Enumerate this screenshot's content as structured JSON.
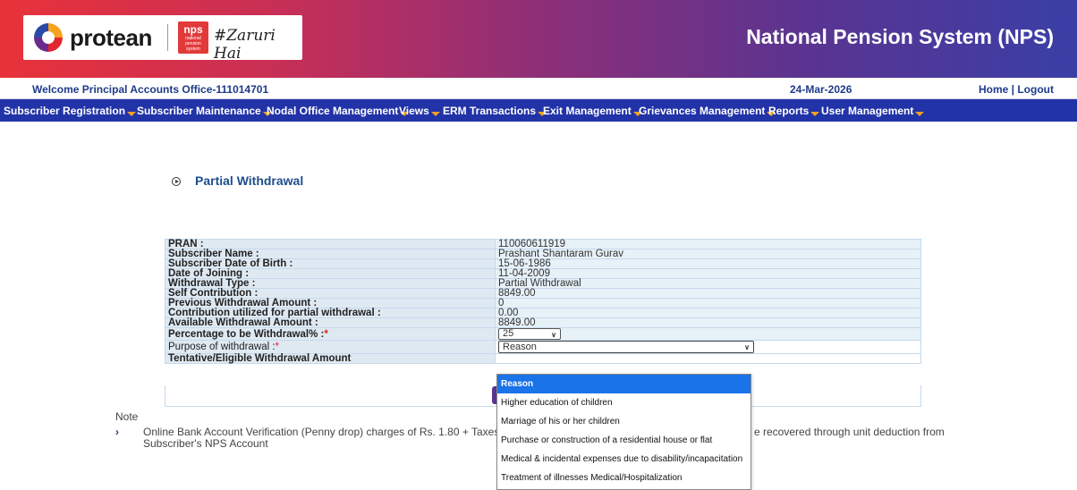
{
  "header": {
    "brand_name": "protean",
    "nps_badge_title": "nps",
    "nps_badge_sub": "national pension system",
    "tagline": "#Zaruri Hai",
    "site_title": "National Pension System (NPS)",
    "brand_colors": [
      "#e8323a",
      "#8e2f78",
      "#3a3fa6"
    ]
  },
  "info_bar": {
    "welcome": "Welcome Principal Accounts Office-111014701",
    "date": "24-Mar-2026",
    "home_logout": "Home | Logout"
  },
  "nav": {
    "items": [
      "Subscriber Registration",
      "Subscriber Maintenance",
      "Nodal Office Management",
      "Views",
      "ERM Transactions",
      "Exit Management",
      "Grievances Management",
      "Reports",
      "User Management"
    ]
  },
  "section": {
    "title": "Partial Withdrawal"
  },
  "details": {
    "rows": [
      {
        "label": "PRAN :",
        "value": "110060611919"
      },
      {
        "label": "Subscriber Name :",
        "value": "Prashant Shantaram Gurav"
      },
      {
        "label": "Subscriber Date of Birth :",
        "value": "15-06-1986"
      },
      {
        "label": "Date of Joining :",
        "value": "11-04-2009"
      },
      {
        "label": "Withdrawal Type :",
        "value": "Partial Withdrawal"
      },
      {
        "label": "Self Contribution :",
        "value": "8849.00"
      },
      {
        "label": "Previous Withdrawal Amount :",
        "value": "0"
      },
      {
        "label": "Contribution utilized for partial withdrawal :",
        "value": "0.00"
      },
      {
        "label": "Available Withdrawal Amount :",
        "value": "8849.00"
      }
    ],
    "percentage_label": "Percentage to be Withdrawal% :",
    "percentage_value": "25",
    "purpose_label": "Purpose of withdrawal :",
    "purpose_value": "Reason",
    "tentative_label": "Tentative/Eligible Withdrawal Amount",
    "required_mark": "*"
  },
  "dropdown": {
    "options": [
      "Reason",
      "Higher education of children",
      "Marriage of his or her children",
      "Purchase or construction of a residential house or flat",
      "Medical & incidental expenses due to disability/incapacitation",
      "Treatment of illnesses Medical/Hospitalization"
    ]
  },
  "note": {
    "label": "Note",
    "arrow": "›",
    "text_part1": "Online Bank Account Verification (Penny drop) charges of Rs. 1.80 + Taxes will be a",
    "text_part1_end": "e recovered through unit deduction from",
    "text_part2": "Subscriber's NPS Account"
  }
}
